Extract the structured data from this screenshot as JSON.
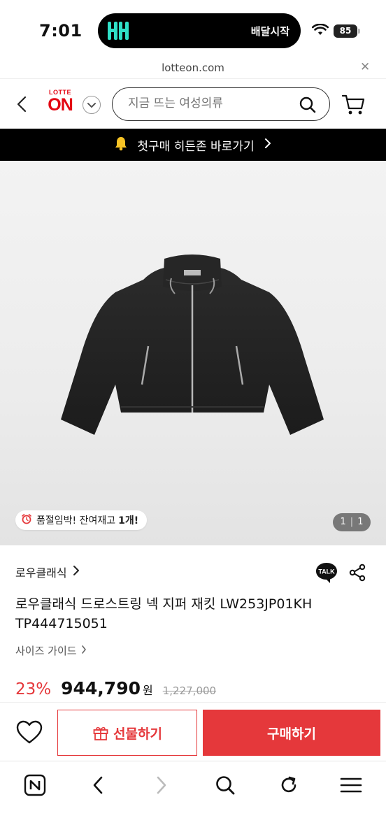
{
  "status_bar": {
    "time": "7:01",
    "live_activity_text": "배달시작",
    "battery": "85",
    "icons": [
      "wifi-icon",
      "battery-icon"
    ]
  },
  "browser": {
    "url": "lotteon.com",
    "toolbar_icons": [
      "naver-icon",
      "back-icon",
      "forward-icon",
      "search-icon",
      "refresh-icon",
      "menu-icon"
    ]
  },
  "header": {
    "logo_top": "LOTTE",
    "logo_main": "ON",
    "search_placeholder": "지금 뜨는 여성의류"
  },
  "promo": {
    "text": "첫구매 히든존 바로가기"
  },
  "gallery": {
    "stock_text": "품절임박! 잔여재고",
    "stock_count": "1개!",
    "page_current": "1",
    "page_total": "1"
  },
  "product": {
    "brand": "로우클래식",
    "title_line1": "로우클래식 드로스트링 넥 지퍼 재킷 LW253JP01KH",
    "title_line2": "TP444715051",
    "size_guide": "사이즈 가이드",
    "talk_label": "TALK",
    "discount": "23%",
    "price": "944,790",
    "currency": "원",
    "original_price": "1,227,000"
  },
  "actions": {
    "gift_label": "선물하기",
    "buy_label": "구매하기"
  },
  "colors": {
    "accent": "#e5383b",
    "brand": "#e30613",
    "promo_bg": "#000000"
  }
}
